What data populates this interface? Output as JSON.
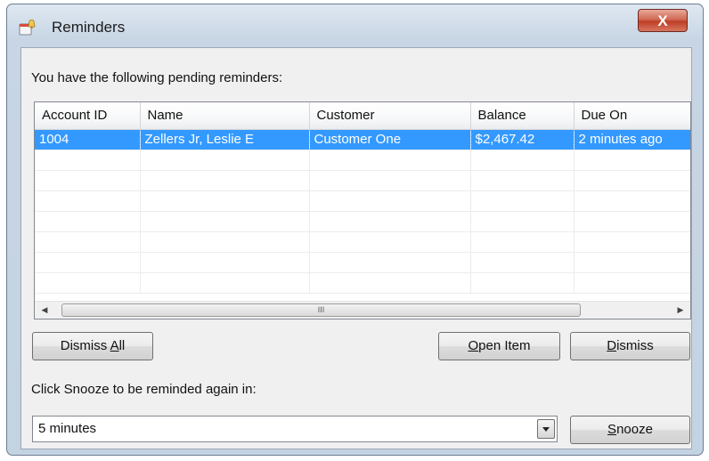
{
  "window": {
    "title": "Reminders",
    "close_glyph": "X",
    "icon": "reminder-bell-icon"
  },
  "prompt": "You have the following pending reminders:",
  "list": {
    "columns": [
      "Account ID",
      "Name",
      "Customer",
      "Balance",
      "Due On"
    ],
    "rows": [
      {
        "account_id": "1004",
        "name": "Zellers Jr, Leslie E",
        "customer": "Customer One",
        "balance": "$2,467.42",
        "due_on": "2 minutes ago",
        "selected": true
      }
    ],
    "scrollbar": {
      "left_arrow": "◀",
      "right_arrow": "▶",
      "grip": "III"
    }
  },
  "buttons": {
    "dismiss_all": {
      "pre": "Dismiss ",
      "key": "A",
      "post": "ll"
    },
    "open_item": {
      "pre": "",
      "key": "O",
      "post": "pen Item"
    },
    "dismiss": {
      "pre": "",
      "key": "D",
      "post": "ismiss"
    },
    "snooze": {
      "pre": "",
      "key": "S",
      "post": "nooze"
    }
  },
  "snooze_label": "Click Snooze to be reminded again in:",
  "snooze_combo": {
    "value": "5 minutes"
  },
  "colors": {
    "selection": "#3399ff",
    "close_button": "#c94a32",
    "frame": "#c4d3e2"
  }
}
